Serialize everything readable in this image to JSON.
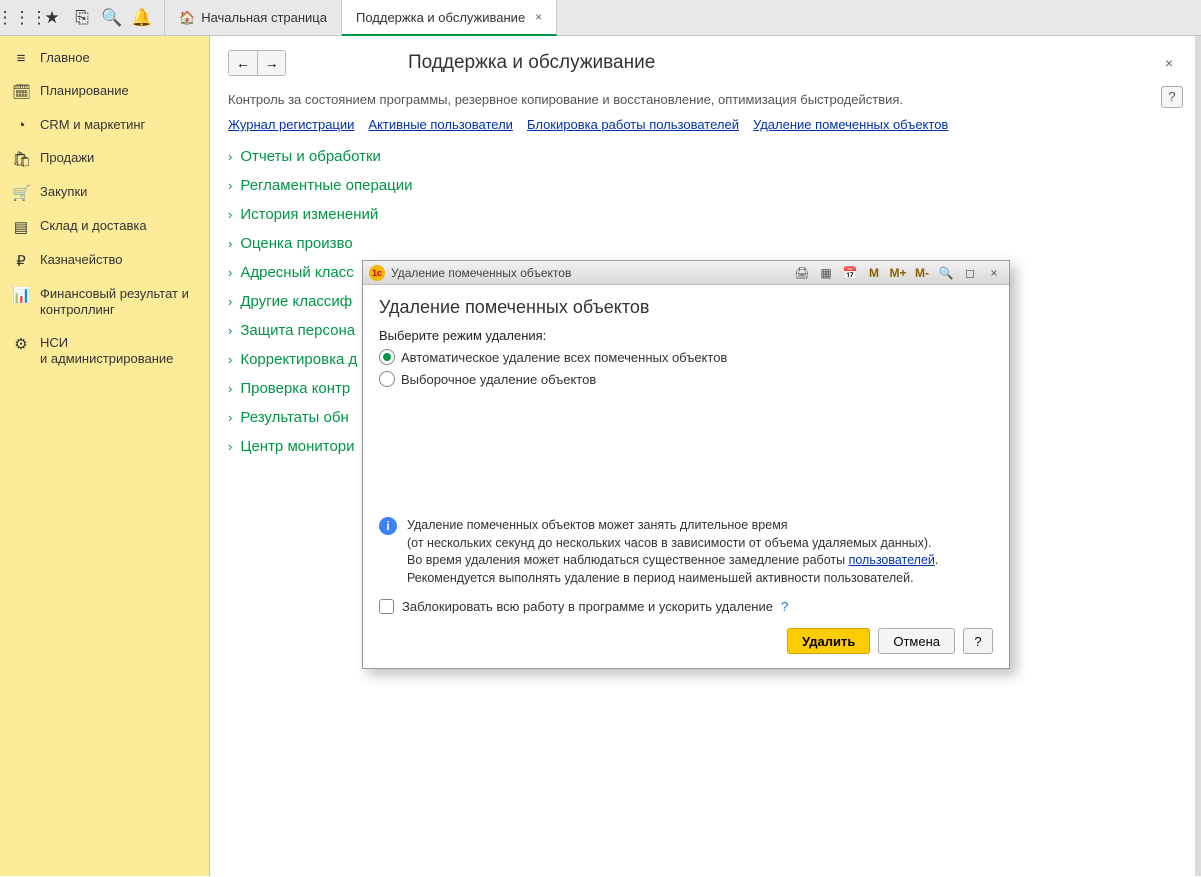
{
  "tabs": {
    "home_label": "Начальная страница",
    "active_label": "Поддержка и обслуживание"
  },
  "sidebar": [
    {
      "icon": "≡",
      "label": "Главное",
      "name": "sidebar-main"
    },
    {
      "icon": "🗓",
      "label": "Планирование",
      "name": "sidebar-planning"
    },
    {
      "icon": "◔",
      "label": "CRM и маркетинг",
      "name": "sidebar-crm"
    },
    {
      "icon": "🛍",
      "label": "Продажи",
      "name": "sidebar-sales"
    },
    {
      "icon": "🛒",
      "label": "Закупки",
      "name": "sidebar-purchases"
    },
    {
      "icon": "▤",
      "label": "Склад и доставка",
      "name": "sidebar-warehouse"
    },
    {
      "icon": "₽",
      "label": "Казначейство",
      "name": "sidebar-treasury"
    },
    {
      "icon": "📊",
      "label": "Финансовый результат и контроллинг",
      "name": "sidebar-finance"
    },
    {
      "icon": "⚙",
      "label": "НСИ\nи администрирование",
      "name": "sidebar-admin"
    }
  ],
  "page": {
    "title": "Поддержка и обслуживание",
    "description": "Контроль за состоянием программы, резервное копирование и восстановление, оптимизация быстродействия.",
    "links": [
      "Журнал регистрации",
      "Активные пользователи",
      "Блокировка работы пользователей",
      "Удаление помеченных объектов"
    ],
    "tree": [
      "Отчеты и обработки",
      "Регламентные операции",
      "История изменений",
      "Оценка произво",
      "Адресный класс",
      "Другие классиф",
      "Защита персона",
      "Корректировка д",
      "Проверка контр",
      "Результаты обн",
      "Центр монитори"
    ]
  },
  "modal": {
    "window_title": "Удаление помеченных объектов",
    "heading": "Удаление помеченных объектов",
    "select_mode_label": "Выберите режим удаления:",
    "radio_auto": "Автоматическое удаление всех помеченных объектов",
    "radio_selective": "Выборочное удаление объектов",
    "info_line1": "Удаление помеченных объектов может занять длительное время",
    "info_line2": "(от нескольких секунд до нескольких часов в зависимости от объема удаляемых данных).",
    "info_line3_a": "Во время удаления может наблюдаться существенное замедление работы ",
    "info_line3_link": "пользователей",
    "info_line3_b": ".",
    "info_line4": "Рекомендуется выполнять удаление в период наименьшей активности пользователей.",
    "checkbox_label": "Заблокировать всю работу в программе и ускорить удаление",
    "btn_delete": "Удалить",
    "btn_cancel": "Отмена",
    "toolbar_m": "M",
    "toolbar_mplus": "M+",
    "toolbar_mminus": "M-"
  },
  "glyphs": {
    "help": "?",
    "close": "×",
    "back": "←",
    "forward": "→",
    "chevron": "›"
  }
}
